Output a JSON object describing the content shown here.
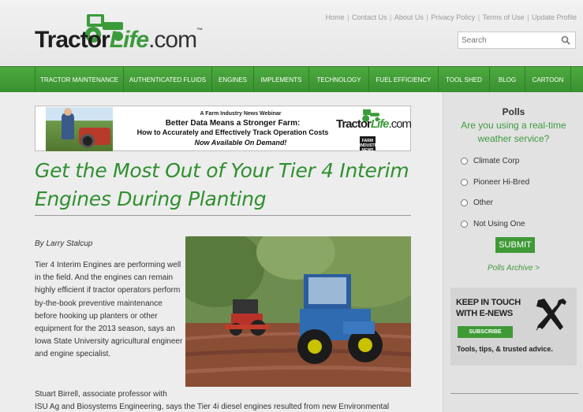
{
  "header": {
    "logo": {
      "part1": "Tractor",
      "part2": "Life",
      "part3": ".com",
      "tm": "™"
    },
    "top_links": [
      "Home",
      "Contact Us",
      "About Us",
      "Privacy Policy",
      "Terms of Use",
      "Update Profile"
    ],
    "search_placeholder": "Search"
  },
  "nav": {
    "items": [
      "TRACTOR MAINTENANCE",
      "AUTHENTICATED FLUIDS",
      "ENGINES",
      "IMPLEMENTS",
      "TECHNOLOGY",
      "FUEL EFFICIENCY",
      "TOOL SHED",
      "BLOG",
      "CARTOON"
    ]
  },
  "banner": {
    "line1": "A Farm Industry News Webinar",
    "line2": "Better Data Means a Stronger Farm:",
    "line3": "How to Accurately and Effectively Track Operation Costs",
    "line4": "Now Available On Demand!",
    "logo_part1": "Tractor",
    "logo_part2": "Life",
    "logo_part3": ".com",
    "badge": "FARM INDUSTRY NEWS"
  },
  "article": {
    "title_line1": "Get the Most Out of Your Tier 4 Interim",
    "title_line2": "Engines During Planting",
    "byline": "By Larry Stalcup",
    "para1": "Tier 4 Interim Engines are performing well in the field. And the engines can remain highly efficient if tractor operators perform by-the-book preventive maintenance before hooking up planters or other equipment for the 2013 season, says an Iowa State University agricultural engineer and engine specialist.",
    "para2_line1": "Stuart Birrell, associate professor with",
    "para2_line2": "ISU Ag and Biosystems Engineering, says the Tier 4i diesel engines resulted from new Environmental"
  },
  "polls": {
    "title": "Polls",
    "question": "Are you using a real-time weather service?",
    "options": [
      "Climate Corp",
      "Pioneer Hi-Bred",
      "Other",
      "Not Using One"
    ],
    "submit": "SUBMIT",
    "archive": "Polls Archive >"
  },
  "enews": {
    "heading_line1": "KEEP IN TOUCH",
    "heading_line2": "WITH E-NEWS",
    "subscribe": "SUBSCRIBE",
    "tagline": "Tools, tips, & trusted advice."
  },
  "colors": {
    "green": "#3f9a36",
    "title_green": "#2f8f2f",
    "nav_green": "#4caa3f"
  }
}
